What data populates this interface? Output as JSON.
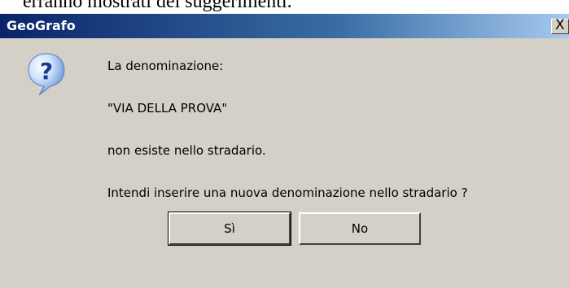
{
  "background_doc": {
    "text": "erranno mostrati dei suggerimenti."
  },
  "dialog": {
    "title": "GeoGrafo",
    "close_symbol": "X",
    "icon": "question-icon",
    "lines": [
      "La denominazione:",
      "\"VIA DELLA PROVA\"",
      "non esiste nello stradario.",
      "Intendi inserire una nuova denominazione nello stradario ?"
    ],
    "buttons": {
      "yes": "Sì",
      "no": "No"
    }
  },
  "colors": {
    "title_start": "#0a246a",
    "title_end": "#a6caf0",
    "dialog_bg": "#d4d0c8"
  }
}
